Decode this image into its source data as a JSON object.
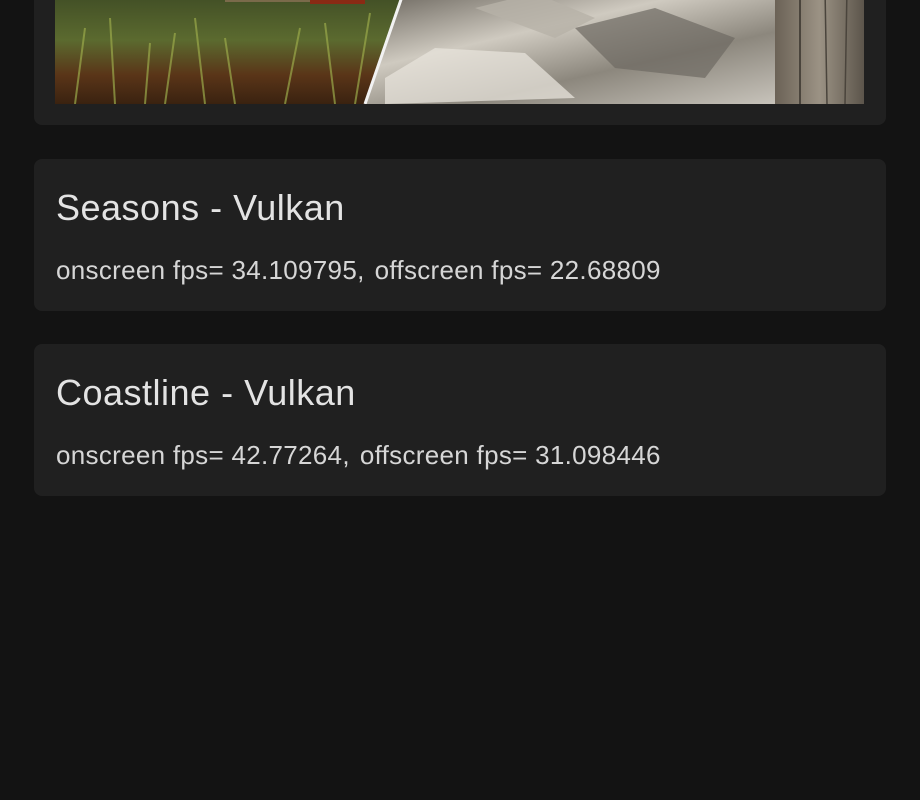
{
  "benchmarks": [
    {
      "title": "Seasons - Vulkan",
      "onscreen_label": "onscreen fps= 34.109795,",
      "offscreen_label": "offscreen fps= 22.68809"
    },
    {
      "title": "Coastline - Vulkan",
      "onscreen_label": "onscreen fps= 42.77264,",
      "offscreen_label": "offscreen fps= 31.098446"
    }
  ],
  "colors": {
    "background": "#131313",
    "card": "#202020",
    "text": "#e3e3e3"
  }
}
